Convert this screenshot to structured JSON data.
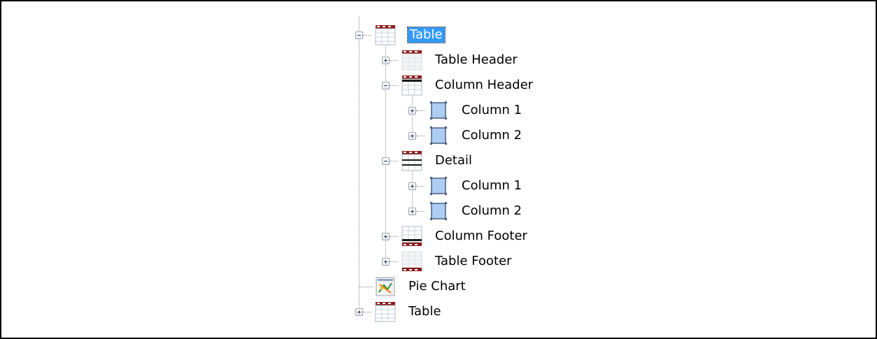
{
  "tree": {
    "table_1": {
      "label": "Table",
      "selected": true,
      "state": "expanded"
    },
    "table_header": {
      "label": "Table Header",
      "state": "collapsed"
    },
    "column_header": {
      "label": "Column Header",
      "state": "expanded",
      "children": [
        {
          "label": "Column 1",
          "state": "collapsed"
        },
        {
          "label": "Column 2",
          "state": "collapsed"
        }
      ]
    },
    "detail": {
      "label": "Detail",
      "state": "expanded",
      "children": [
        {
          "label": "Column 1",
          "state": "collapsed"
        },
        {
          "label": "Column 2",
          "state": "collapsed"
        }
      ]
    },
    "column_footer": {
      "label": "Column Footer",
      "state": "collapsed"
    },
    "table_footer": {
      "label": "Table Footer",
      "state": "collapsed"
    },
    "pie_chart": {
      "label": "Pie Chart"
    },
    "table_2": {
      "label": "Table",
      "state": "collapsed"
    }
  },
  "colors": {
    "selection": "#3399ff",
    "band_red": "#8b1a1a",
    "cell_blue": "#aecdf2"
  },
  "icons": {
    "table_1": "table-icon",
    "table_header": "table-header-icon",
    "column_header": "column-header-icon",
    "column": "column-cell-icon",
    "detail": "detail-band-icon",
    "column_footer": "column-footer-icon",
    "table_footer": "table-footer-icon",
    "pie_chart": "pie-chart-icon",
    "table_2": "table-icon"
  }
}
